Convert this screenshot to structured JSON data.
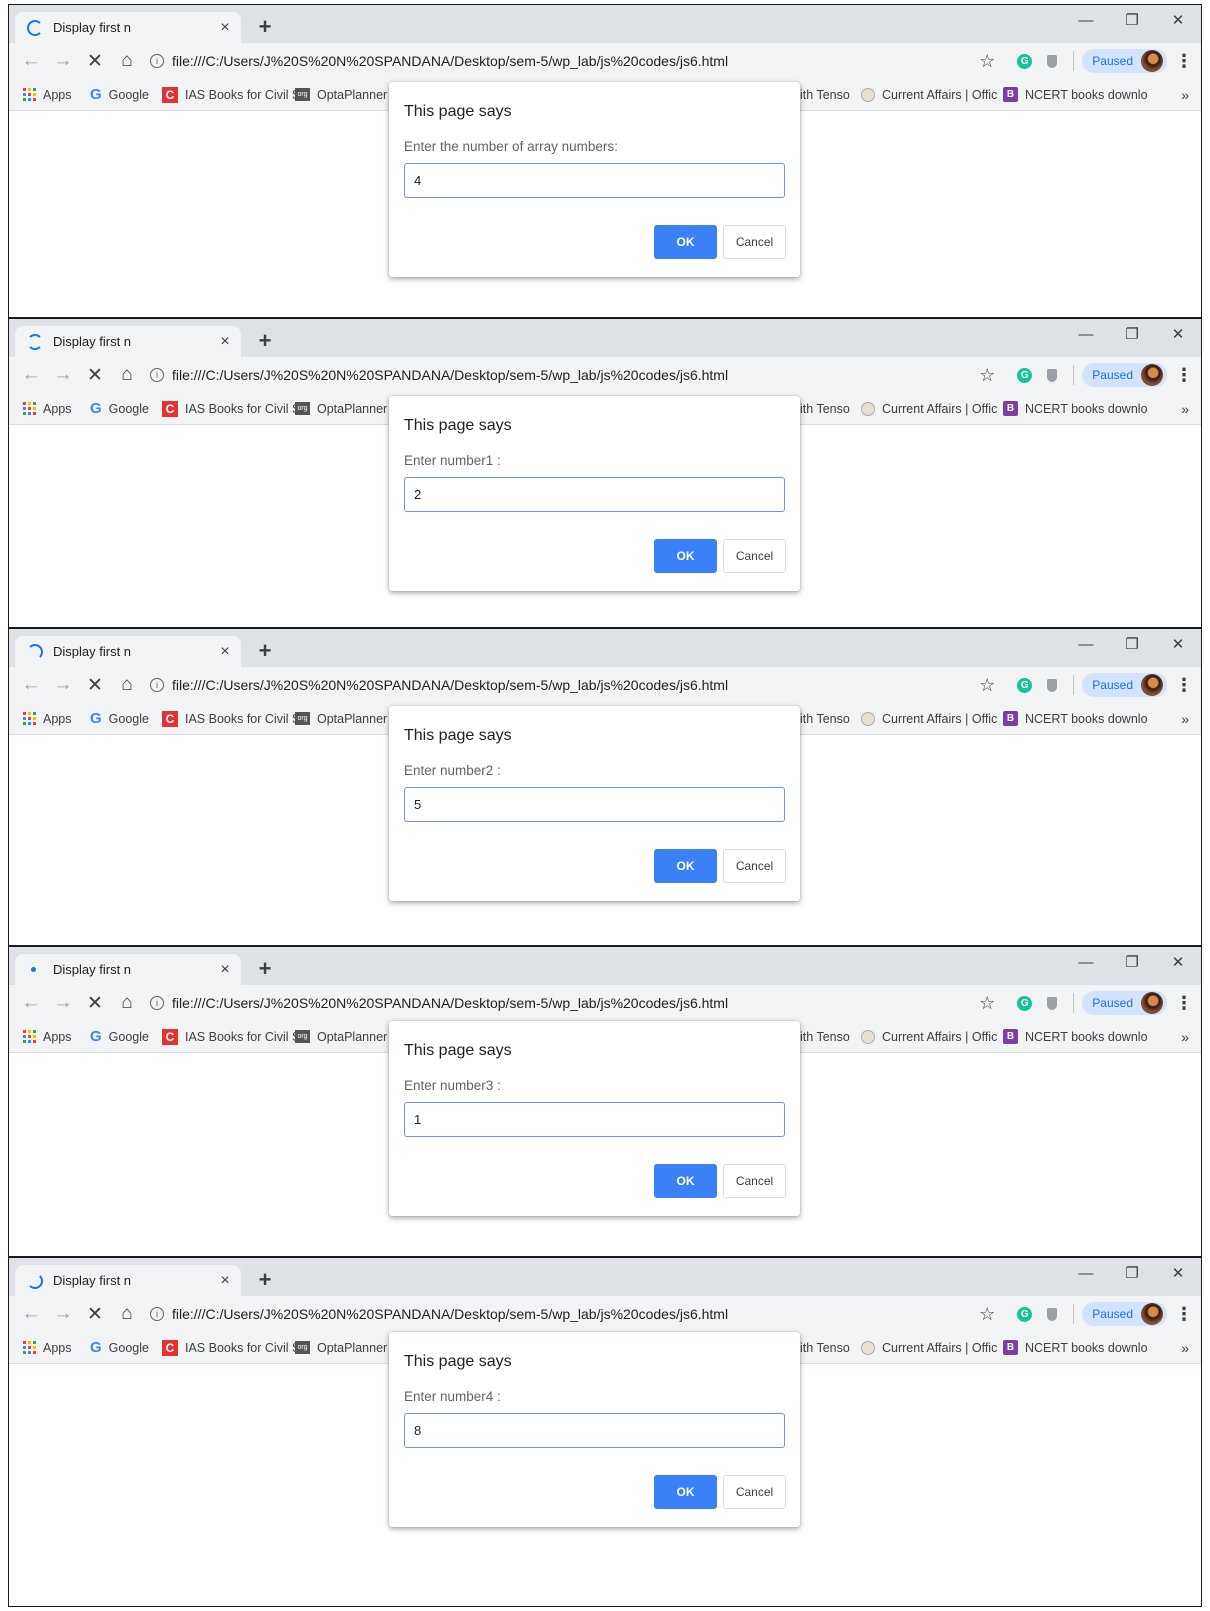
{
  "browser": {
    "tab_title": "Display first n",
    "tab_close": "×",
    "new_tab": "+",
    "window": {
      "minimize": "—",
      "restore": "❐",
      "close": "✕"
    },
    "nav": {
      "back": "←",
      "forward": "→",
      "stop": "✕",
      "home": "⌂"
    },
    "url": "file:///C:/Users/J%20S%20N%20SPANDANA/Desktop/sem-5/wp_lab/js%20codes/js6.html",
    "info_icon": "i",
    "star": "☆",
    "profile_status": "Paused",
    "menu": "⋮",
    "bookmarks": [
      {
        "label": "Apps",
        "icon": "apps-grid-icon"
      },
      {
        "label": "Google",
        "icon": "google-icon"
      },
      {
        "label": "IAS Books for Civil Se",
        "icon": "c-logo-icon"
      },
      {
        "label": "OptaPlanner U",
        "icon": "books-org-icon"
      },
      {
        "label": "ith Tenso",
        "icon": ""
      },
      {
        "label": "Current Affairs | Offic",
        "icon": "current-affairs-icon"
      },
      {
        "label": "NCERT books downlo",
        "icon": "ncert-icon"
      }
    ],
    "bookmarks_more": "»",
    "accent_color": "#1a73e8"
  },
  "dialog_common": {
    "title": "This page says",
    "ok": "OK",
    "cancel": "Cancel",
    "ok_color": "#3b80f6"
  },
  "screens": [
    {
      "message": "Enter the number of array numbers:",
      "value": "4"
    },
    {
      "message": "Enter number1 :",
      "value": "2"
    },
    {
      "message": "Enter number2 :",
      "value": "5"
    },
    {
      "message": "Enter number3 :",
      "value": "1"
    },
    {
      "message": "Enter number4 :",
      "value": "8"
    }
  ]
}
